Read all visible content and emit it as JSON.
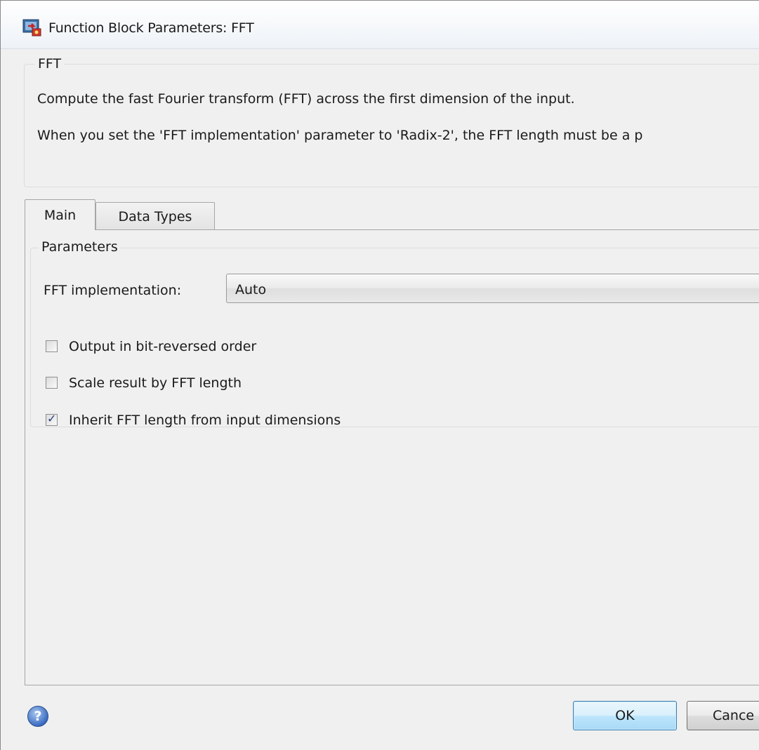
{
  "window": {
    "title": "Function Block Parameters: FFT",
    "icon": "simulink-block-icon"
  },
  "description": {
    "group_label": "FFT",
    "line1": "Compute the fast Fourier transform (FFT) across the first dimension of the input.",
    "line2": "When you set the 'FFT implementation' parameter to 'Radix-2', the FFT length must be a p"
  },
  "tabs": [
    {
      "label": "Main",
      "selected": true
    },
    {
      "label": "Data Types",
      "selected": false
    }
  ],
  "parameters": {
    "group_label": "Parameters",
    "fft_implementation": {
      "label": "FFT implementation:",
      "value": "Auto"
    },
    "checkboxes": [
      {
        "label": "Output in bit-reversed order",
        "checked": false
      },
      {
        "label": "Scale result by FFT length",
        "checked": false
      },
      {
        "label": "Inherit FFT length from input dimensions",
        "checked": true
      }
    ],
    "check_glyph": "✓"
  },
  "footer": {
    "help_glyph": "?",
    "ok_label": "OK",
    "cancel_label": "Cance"
  }
}
